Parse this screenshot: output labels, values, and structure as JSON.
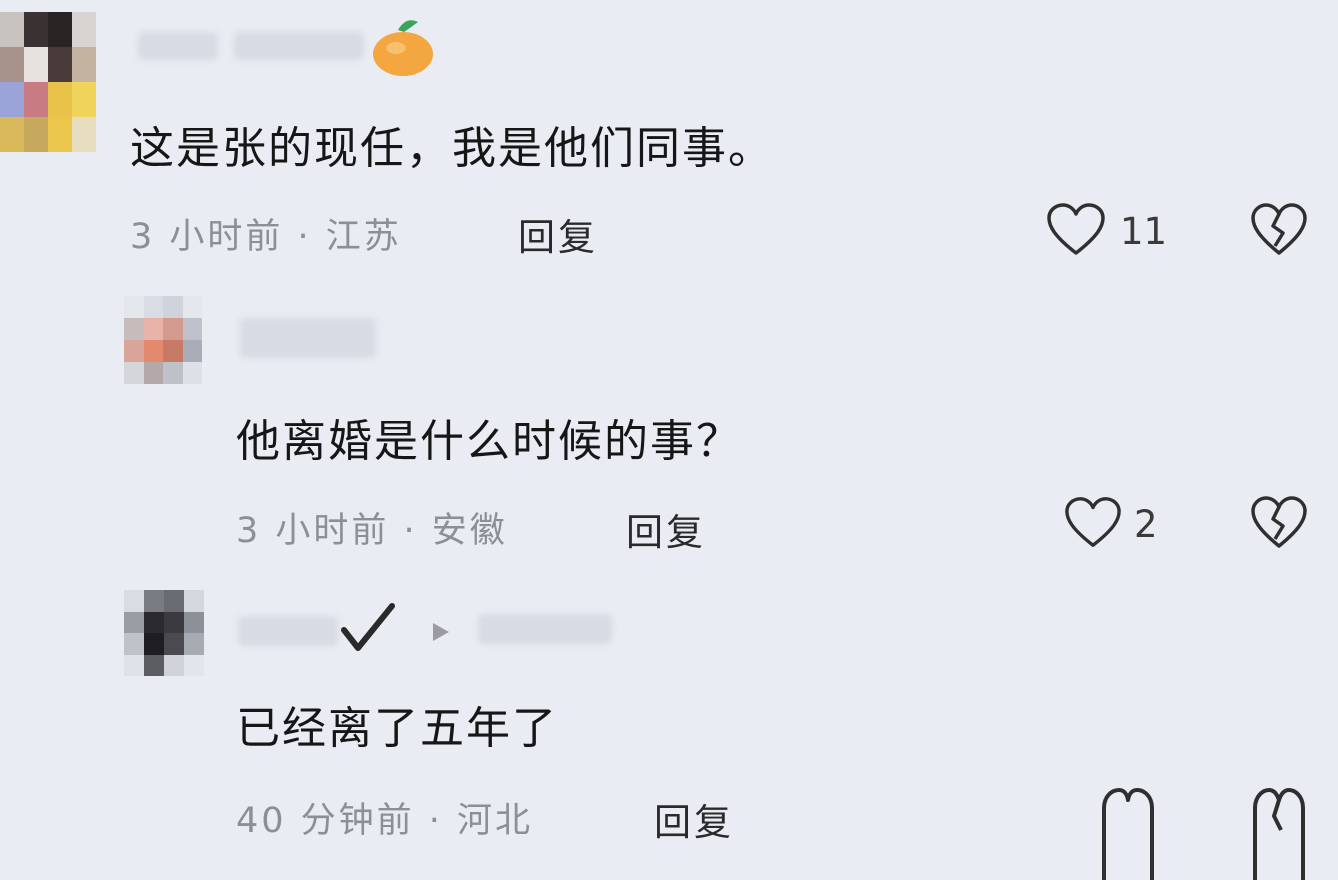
{
  "comments": [
    {
      "text": "这是张的现任，我是他们同事。",
      "time": "3 小时前 · 江苏",
      "reply_label": "回复",
      "likes": "11"
    },
    {
      "text": "他离婚是什么时候的事？",
      "time": "3 小时前 · 安徽",
      "reply_label": "回复",
      "likes": "2"
    },
    {
      "text": "已经离了五年了",
      "time": "40 分钟前 · 河北",
      "reply_label": "回复",
      "likes": ""
    }
  ],
  "icons": {
    "like": "heart-outline-icon",
    "dislike": "broken-heart-icon",
    "verified": "checkmark-icon",
    "reply_arrow": "triangle-right-icon"
  },
  "colors": {
    "background": "#e9ecf2",
    "text": "#161616",
    "meta": "#8c8f95"
  }
}
